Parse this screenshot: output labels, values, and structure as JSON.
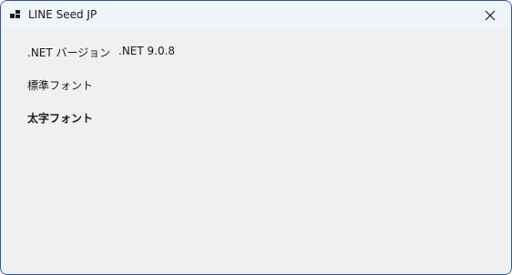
{
  "window": {
    "title": "LINE Seed JP",
    "app_icon": "app-window-icon",
    "close_icon": "close-icon"
  },
  "content": {
    "net_version_label": ".NET バージョン",
    "net_version_value": ".NET 9.0.8",
    "regular_font_label": "標準フォント",
    "bold_font_label": "太字フォント"
  }
}
